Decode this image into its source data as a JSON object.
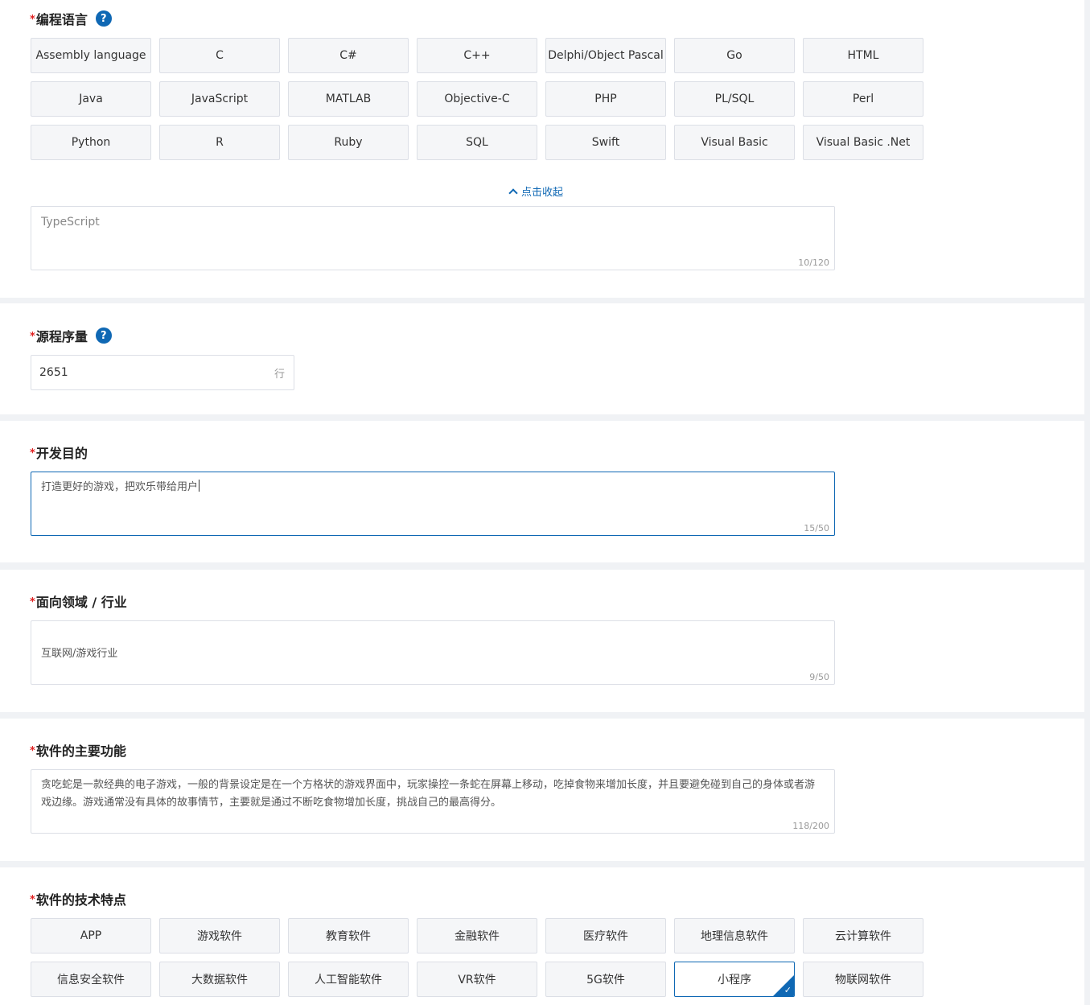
{
  "language": {
    "title": "编程语言",
    "options": [
      "Assembly language",
      "C",
      "C#",
      "C++",
      "Delphi/Object Pascal",
      "Go",
      "HTML",
      "Java",
      "JavaScript",
      "MATLAB",
      "Objective-C",
      "PHP",
      "PL/SQL",
      "Perl",
      "Python",
      "R",
      "Ruby",
      "SQL",
      "Swift",
      "Visual Basic",
      "Visual Basic .Net"
    ],
    "collapse_label": "点击收起",
    "other_value": "TypeScript",
    "other_counter": "10/120"
  },
  "source_lines": {
    "title": "源程序量",
    "value": "2651",
    "unit": "行"
  },
  "purpose": {
    "title": "开发目的",
    "value": "打造更好的游戏，把欢乐带给用户",
    "counter": "15/50"
  },
  "domain": {
    "title": "面向领域 / 行业",
    "value": "互联网/游戏行业",
    "counter": "9/50"
  },
  "functions": {
    "title": "软件的主要功能",
    "value": "贪吃蛇是一款经典的电子游戏，一般的背景设定是在一个方格状的游戏界面中，玩家操控一条蛇在屏幕上移动，吃掉食物来增加长度，并且要避免碰到自己的身体或者游戏边缘。游戏通常没有具体的故事情节，主要就是通过不断吃食物增加长度，挑战自己的最高得分。",
    "counter": "118/200"
  },
  "tech": {
    "title": "软件的技术特点",
    "options": [
      "APP",
      "游戏软件",
      "教育软件",
      "金融软件",
      "医疗软件",
      "地理信息软件",
      "云计算软件",
      "信息安全软件",
      "大数据软件",
      "人工智能软件",
      "VR软件",
      "5G软件",
      "小程序",
      "物联网软件"
    ],
    "selected": "小程序"
  },
  "icons": {
    "help": "question-circle-icon",
    "collapse": "chevron-up-icon",
    "selected_mark": "checkmark-icon"
  },
  "colors": {
    "accent": "#0f68b4",
    "required": "#e02020",
    "chip_bg": "#f5f6f8",
    "border": "#dcdfe6"
  }
}
